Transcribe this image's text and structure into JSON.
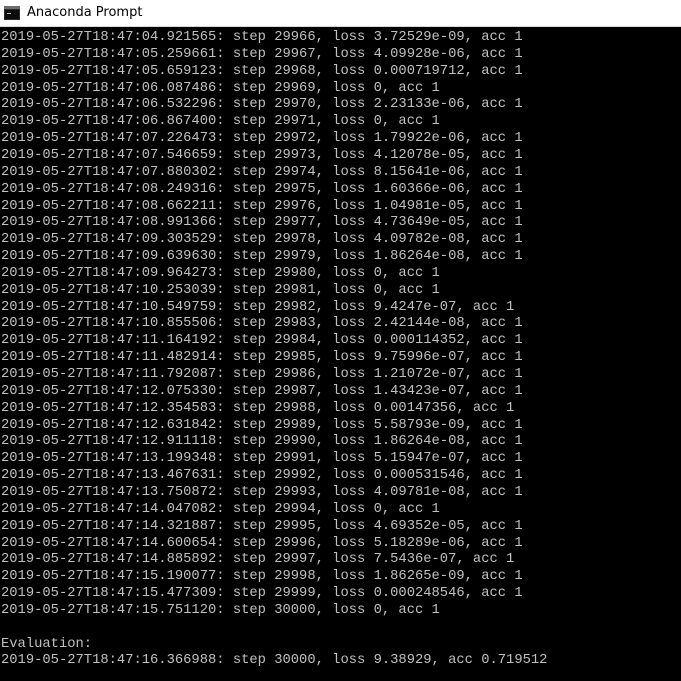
{
  "window": {
    "title": "Anaconda Prompt",
    "icon": "console-icon",
    "colors": {
      "background": "#000000",
      "text": "#c0c0c0",
      "titlebar": "#ffffff"
    }
  },
  "console": {
    "lines": [
      "2019-05-27T18:47:04.921565: step 29966, loss 3.72529e-09, acc 1",
      "2019-05-27T18:47:05.259661: step 29967, loss 4.09928e-06, acc 1",
      "2019-05-27T18:47:05.659123: step 29968, loss 0.000719712, acc 1",
      "2019-05-27T18:47:06.087486: step 29969, loss 0, acc 1",
      "2019-05-27T18:47:06.532296: step 29970, loss 2.23133e-06, acc 1",
      "2019-05-27T18:47:06.867400: step 29971, loss 0, acc 1",
      "2019-05-27T18:47:07.226473: step 29972, loss 1.79922e-06, acc 1",
      "2019-05-27T18:47:07.546659: step 29973, loss 4.12078e-05, acc 1",
      "2019-05-27T18:47:07.880302: step 29974, loss 8.15641e-06, acc 1",
      "2019-05-27T18:47:08.249316: step 29975, loss 1.60366e-06, acc 1",
      "2019-05-27T18:47:08.662211: step 29976, loss 1.04981e-05, acc 1",
      "2019-05-27T18:47:08.991366: step 29977, loss 4.73649e-05, acc 1",
      "2019-05-27T18:47:09.303529: step 29978, loss 4.09782e-08, acc 1",
      "2019-05-27T18:47:09.639630: step 29979, loss 1.86264e-08, acc 1",
      "2019-05-27T18:47:09.964273: step 29980, loss 0, acc 1",
      "2019-05-27T18:47:10.253039: step 29981, loss 0, acc 1",
      "2019-05-27T18:47:10.549759: step 29982, loss 9.4247e-07, acc 1",
      "2019-05-27T18:47:10.855506: step 29983, loss 2.42144e-08, acc 1",
      "2019-05-27T18:47:11.164192: step 29984, loss 0.000114352, acc 1",
      "2019-05-27T18:47:11.482914: step 29985, loss 9.75996e-07, acc 1",
      "2019-05-27T18:47:11.792087: step 29986, loss 1.21072e-07, acc 1",
      "2019-05-27T18:47:12.075330: step 29987, loss 1.43423e-07, acc 1",
      "2019-05-27T18:47:12.354583: step 29988, loss 0.00147356, acc 1",
      "2019-05-27T18:47:12.631842: step 29989, loss 5.58793e-09, acc 1",
      "2019-05-27T18:47:12.911118: step 29990, loss 1.86264e-08, acc 1",
      "2019-05-27T18:47:13.199348: step 29991, loss 5.15947e-07, acc 1",
      "2019-05-27T18:47:13.467631: step 29992, loss 0.000531546, acc 1",
      "2019-05-27T18:47:13.750872: step 29993, loss 4.09781e-08, acc 1",
      "2019-05-27T18:47:14.047082: step 29994, loss 0, acc 1",
      "2019-05-27T18:47:14.321887: step 29995, loss 4.69352e-05, acc 1",
      "2019-05-27T18:47:14.600654: step 29996, loss 5.18289e-06, acc 1",
      "2019-05-27T18:47:14.885892: step 29997, loss 7.5436e-07, acc 1",
      "2019-05-27T18:47:15.190077: step 29998, loss 1.86265e-09, acc 1",
      "2019-05-27T18:47:15.477309: step 29999, loss 0.000248546, acc 1",
      "2019-05-27T18:47:15.751120: step 30000, loss 0, acc 1",
      "",
      "Evaluation:",
      "2019-05-27T18:47:16.366988: step 30000, loss 9.38929, acc 0.719512"
    ]
  }
}
